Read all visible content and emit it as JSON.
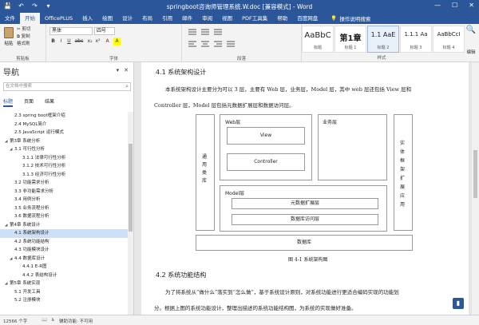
{
  "titlebar": {
    "title": "springboot咨询师管理系统.W.doc [兼容模式] - Word",
    "qat": [
      "save-icon",
      "undo-icon",
      "redo-icon",
      "customize-icon"
    ],
    "qat_glyphs": [
      "💾",
      "↶",
      "↷",
      "▾"
    ],
    "controls": [
      "—",
      "☐",
      "✕"
    ]
  },
  "tabs": {
    "items": [
      "文件",
      "开始",
      "OfficePLUS",
      "插入",
      "绘图",
      "设计",
      "布局",
      "引用",
      "邮件",
      "审阅",
      "视图",
      "PDF工具集",
      "帮助",
      "百度网盘"
    ],
    "active_index": 1,
    "tellme": "操作说明搜索"
  },
  "ribbon": {
    "clipboard": {
      "paste": "粘贴",
      "cut": "✂ 剪切",
      "copy": "⧉ 复制",
      "format_painter": "格式刷",
      "label": "剪贴板"
    },
    "font": {
      "name": "黑体",
      "size": "四号",
      "label": "字体",
      "buttons": [
        "B",
        "I",
        "U",
        "abc",
        "x₂",
        "x²",
        "A",
        "A"
      ]
    },
    "paragraph": {
      "label": "段落"
    },
    "styles": {
      "label": "样式",
      "items": [
        {
          "sample": "AaBbC",
          "name": "标题"
        },
        {
          "sample": "第1章",
          "name": "标题 1"
        },
        {
          "sample": "1.1 AaE",
          "name": "标题 2"
        },
        {
          "sample": "1.1.1 Aa",
          "name": "标题 3"
        },
        {
          "sample": "AaBbCcI",
          "name": "标题 4"
        }
      ],
      "selected_index": 2
    },
    "editing": {
      "label": "编辑"
    }
  },
  "nav": {
    "title": "导航",
    "search_placeholder": "在文档中搜索",
    "tabs": [
      "标题",
      "页面",
      "结果"
    ],
    "items": [
      {
        "text": "2.3 spring boot框架介绍",
        "level": 2
      },
      {
        "text": "2.4 MySQL简介",
        "level": 2
      },
      {
        "text": "2.5 JavaScript 运行模式",
        "level": 2
      },
      {
        "text": "第3章 系统分析",
        "level": 1,
        "tri": "◢"
      },
      {
        "text": "3.1 可行性分析",
        "level": 2,
        "tri": "◢"
      },
      {
        "text": "3.1.1 法律可行性分析",
        "level": 3
      },
      {
        "text": "3.1.2 技术可行性分析",
        "level": 3
      },
      {
        "text": "3.1.3 经济可行性分析",
        "level": 3
      },
      {
        "text": "3.2 功能需求分析",
        "level": 2
      },
      {
        "text": "3.3 非功能需求分析",
        "level": 2
      },
      {
        "text": "3.4 用例分析",
        "level": 2
      },
      {
        "text": "3.5 业务流程分析",
        "level": 2
      },
      {
        "text": "3.6 数据流程分析",
        "level": 2
      },
      {
        "text": "第4章 系统设计",
        "level": 1,
        "tri": "◢"
      },
      {
        "text": "4.1 系统架构设计",
        "level": 2,
        "selected": true
      },
      {
        "text": "4.2 系统功能结构",
        "level": 2
      },
      {
        "text": "4.3 功能模块设计",
        "level": 2
      },
      {
        "text": "4.4 数据库设计",
        "level": 2,
        "tri": "◢"
      },
      {
        "text": "4.4.1 E-R图",
        "level": 3
      },
      {
        "text": "4.4.2 表结构设计",
        "level": 3
      },
      {
        "text": "第5章 系统实现",
        "level": 1,
        "tri": "◢"
      },
      {
        "text": "5.1 开发工具",
        "level": 2
      },
      {
        "text": "5.2 注册模块",
        "level": 2
      }
    ]
  },
  "doc": {
    "heading1": "4.1 系统架构设计",
    "para1_line1": "本系统架构设计主要分为可以 3 层，主要有 Web 层，业务层，Model 层，其中 web 层还包括 View 层和",
    "para1_line2": "Controller 层，Model 层包括元数据扩展层和数据访问层。",
    "diagram": {
      "left_col": "通用类库",
      "web_layer": "Web层",
      "view": "View",
      "controller": "Controller",
      "business_layer": "业务层",
      "model_layer": "Model层",
      "meta_ext": "元数据扩展层",
      "data_access": "数据库访问层",
      "right_col": "实体框架扩展应用",
      "database": "数据库"
    },
    "caption": "图 4-1 系统架构图",
    "heading2": "4.2 系统功能结构",
    "para2_line1": "为了将系统从“做什么”落实到“怎么做”，基于系统设计原则，对系统功能进行更适合编码实现的功能划",
    "para2_line2": "分。根据上图的系统功能设计，整理出描述的系统功能结构图，为系统的实现做好准备。"
  },
  "status": {
    "words": "12566 个字",
    "proof_icon": "proofing-icon",
    "accessibility": "辅助功能: 不可用"
  }
}
